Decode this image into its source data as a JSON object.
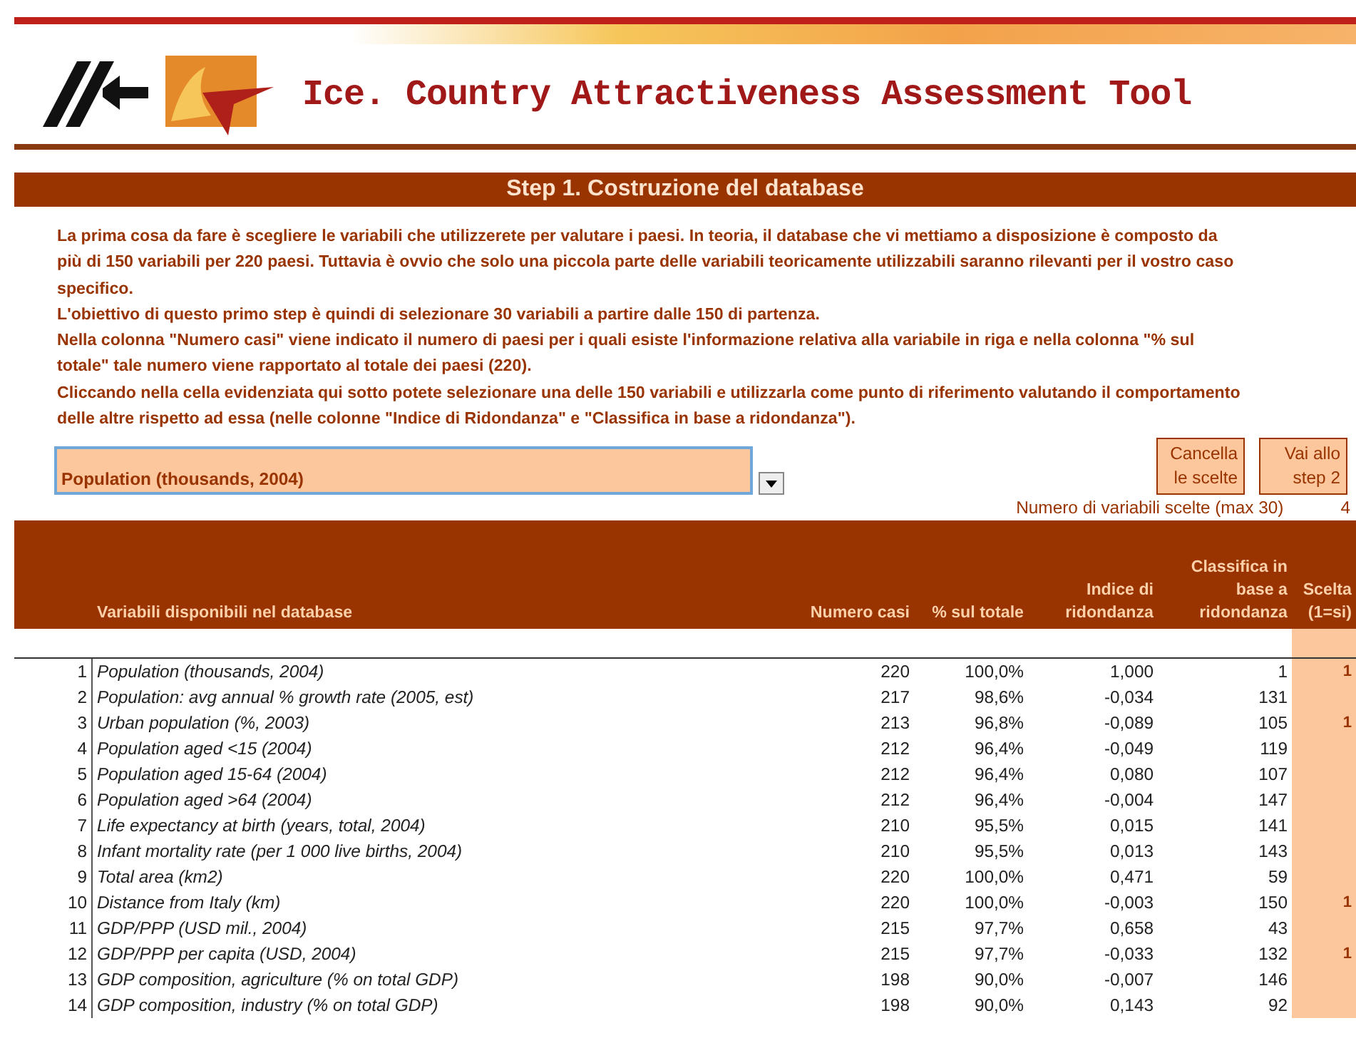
{
  "header": {
    "title": "Ice. Country Attractiveness Assessment Tool"
  },
  "step_title": "Step 1. Costruzione del database",
  "intro": [
    "La prima cosa da fare è scegliere le variabili che utilizzerete per valutare i paesi. In teoria, il database che vi mettiamo a disposizione è composto da più di 150 variabili per 220 paesi. Tuttavia è ovvio che solo una piccola parte delle variabili teoricamente utilizzabili saranno rilevanti per il vostro caso specifico.",
    "L'obiettivo di questo primo step è quindi di selezionare 30 variabili a partire dalle 150 di partenza.",
    "Nella colonna \"Numero casi\" viene indicato il numero di paesi per i quali esiste l'informazione relativa alla variabile in riga e nella colonna \"% sul totale\" tale numero viene rapportato al totale dei paesi (220).",
    "Cliccando nella cella evidenziata qui sotto potete selezionare una delle 150 variabili e utilizzarla come punto di riferimento valutando il comportamento delle altre rispetto ad essa (nelle colonne \"Indice di Ridondanza\" e \"Classifica in base a ridondanza\")."
  ],
  "reference_dropdown": {
    "value": "Population (thousands, 2004)"
  },
  "buttons": [
    "Cancella le scelte",
    "Vai allo step 2"
  ],
  "counter": {
    "label": "Numero di variabili scelte (max 30)",
    "value": "4"
  },
  "table": {
    "columns": [
      "Variabili disponibili nel database",
      "Numero casi",
      "% sul totale",
      "Indice di ridondanza",
      "Classifica in base a ridondanza",
      "Scelta (1=si)"
    ],
    "rows": [
      {
        "n": "1",
        "name": "Population (thousands, 2004)",
        "cases": "220",
        "pct": "100,0%",
        "index": "1,000",
        "rank": "1",
        "choice": "1"
      },
      {
        "n": "2",
        "name": "Population: avg annual % growth rate (2005, est)",
        "cases": "217",
        "pct": "98,6%",
        "index": "-0,034",
        "rank": "131"
      },
      {
        "n": "3",
        "name": "Urban population (%, 2003)",
        "cases": "213",
        "pct": "96,8%",
        "index": "-0,089",
        "rank": "105",
        "choice": "1"
      },
      {
        "n": "4",
        "name": "Population aged <15 (2004)",
        "cases": "212",
        "pct": "96,4%",
        "index": "-0,049",
        "rank": "119"
      },
      {
        "n": "5",
        "name": "Population aged 15-64 (2004)",
        "cases": "212",
        "pct": "96,4%",
        "index": "0,080",
        "rank": "107"
      },
      {
        "n": "6",
        "name": "Population aged >64 (2004)",
        "cases": "212",
        "pct": "96,4%",
        "index": "-0,004",
        "rank": "147"
      },
      {
        "n": "7",
        "name": "Life expectancy at birth (years, total, 2004)",
        "cases": "210",
        "pct": "95,5%",
        "index": "0,015",
        "rank": "141"
      },
      {
        "n": "8",
        "name": "Infant mortality rate (per 1 000 live births, 2004)",
        "cases": "210",
        "pct": "95,5%",
        "index": "0,013",
        "rank": "143"
      },
      {
        "n": "9",
        "name": "Total area (km2)",
        "cases": "220",
        "pct": "100,0%",
        "index": "0,471",
        "rank": "59"
      },
      {
        "n": "10",
        "name": "Distance from Italy (km)",
        "cases": "220",
        "pct": "100,0%",
        "index": "-0,003",
        "rank": "150",
        "choice": "1"
      },
      {
        "n": "11",
        "name": "GDP/PPP (USD mil., 2004)",
        "cases": "215",
        "pct": "97,7%",
        "index": "0,658",
        "rank": "43"
      },
      {
        "n": "12",
        "name": "GDP/PPP per capita (USD, 2004)",
        "cases": "215",
        "pct": "97,7%",
        "index": "-0,033",
        "rank": "132",
        "choice": "1"
      },
      {
        "n": "13",
        "name": "GDP composition, agriculture (% on total GDP)",
        "cases": "198",
        "pct": "90,0%",
        "index": "-0,007",
        "rank": "146"
      },
      {
        "n": "14",
        "name": "GDP composition, industry (% on total GDP)",
        "cases": "198",
        "pct": "90,0%",
        "index": "0,143",
        "rank": "92"
      }
    ]
  }
}
